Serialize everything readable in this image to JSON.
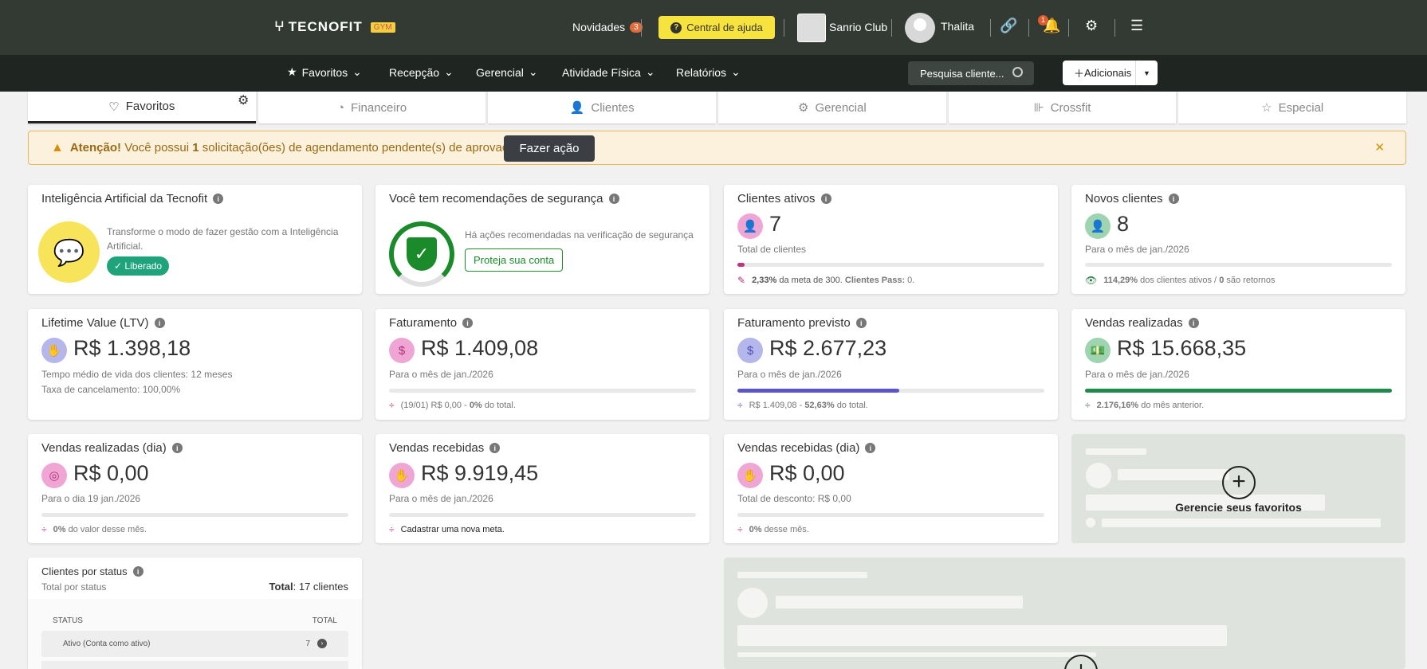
{
  "header": {
    "logo_text": "TECNOFIT",
    "logo_badge": "GYM",
    "novidades_label": "Novidades",
    "novidades_count": "3",
    "help_label": "Central de ajuda",
    "club_name": "Sanrio Club",
    "user_name": "Thalita",
    "notification_count": "1"
  },
  "nav": {
    "items": [
      "Favoritos",
      "Recepção",
      "Gerencial",
      "Atividade Física",
      "Relatórios"
    ],
    "search_placeholder": "Pesquisa cliente...",
    "add_label": "Adicionais"
  },
  "tabs": [
    "Favoritos",
    "Financeiro",
    "Clientes",
    "Gerencial",
    "Crossfit",
    "Especial"
  ],
  "alert": {
    "prefix": "Atenção!",
    "text_before": "Você possui",
    "count": "1",
    "text_after": "solicitação(ões) de agendamento pendente(s) de aprovação.",
    "action": "Fazer ação"
  },
  "cards": {
    "ia": {
      "title": "Inteligência Artificial da Tecnofit",
      "desc": "Transforme o modo de fazer gestão com a Inteligência Artificial.",
      "badge": "Liberado"
    },
    "seg": {
      "title": "Você tem recomendações de segurança",
      "desc": "Há ações recomendadas na verificação de segurança",
      "button": "Proteja sua conta"
    },
    "ativos": {
      "title": "Clientes ativos",
      "value": "7",
      "sub": "Total de clientes",
      "foot_pct": "2,33%",
      "foot_text": "da meta de 300.",
      "foot_pass": "Clientes Pass:",
      "foot_pass_val": "0.",
      "progress": 2.33
    },
    "novos": {
      "title": "Novos clientes",
      "value": "8",
      "sub": "Para o mês de jan./2026",
      "foot_pct": "114,29%",
      "foot_text": "dos clientes ativos /",
      "foot_ret": "0",
      "foot_ret_text": "são retornos",
      "progress": 100
    },
    "ltv": {
      "title": "Lifetime Value (LTV)",
      "value": "R$ 1.398,18",
      "sub1": "Tempo médio de vida dos clientes: 12 meses",
      "sub2": "Taxa de cancelamento: 100,00%"
    },
    "fat": {
      "title": "Faturamento",
      "value": "R$ 1.409,08",
      "sub": "Para o mês de jan./2026",
      "foot_a": "(19/01) R$ 0,00 -",
      "foot_pct": "0%",
      "foot_b": "do total.",
      "progress": 0
    },
    "fatprev": {
      "title": "Faturamento previsto",
      "value": "R$ 2.677,23",
      "sub": "Para o mês de jan./2026",
      "foot_a": "R$ 1.409,08 -",
      "foot_pct": "52,63%",
      "foot_b": "do total.",
      "progress": 52.63
    },
    "vendas": {
      "title": "Vendas realizadas",
      "value": "R$ 15.668,35",
      "sub": "Para o mês de jan./2026",
      "foot_pct": "2.176,16%",
      "foot_b": "do mês anterior.",
      "progress": 100
    },
    "vendasdia": {
      "title": "Vendas realizadas (dia)",
      "value": "R$ 0,00",
      "sub": "Para o dia 19 jan./2026",
      "foot_pct": "0%",
      "foot_b": "do valor desse mês.",
      "progress": 0
    },
    "receb": {
      "title": "Vendas recebidas",
      "value": "R$ 9.919,45",
      "sub": "Para o mês de jan./2026",
      "foot_b": "Cadastrar uma nova meta.",
      "progress": 0
    },
    "recebdia": {
      "title": "Vendas recebidas (dia)",
      "value": "R$ 0,00",
      "sub": "Total de desconto: R$ 0,00",
      "foot_pct": "0%",
      "foot_b": "desse mês.",
      "progress": 0
    },
    "fav": {
      "label": "Gerencie seus favoritos"
    },
    "status": {
      "title": "Clientes por status",
      "sub": "Total por status",
      "total_label": "Total",
      "total_value": ": 17 clientes",
      "col1": "STATUS",
      "col2": "TOTAL",
      "row1_label": "Ativo (Conta como ativo)",
      "row1_value": "7"
    }
  },
  "colors": {
    "topbar": "#323a33",
    "navbar": "#1f2520",
    "accent_yellow": "#f7e33d",
    "green": "#1fa37a"
  }
}
